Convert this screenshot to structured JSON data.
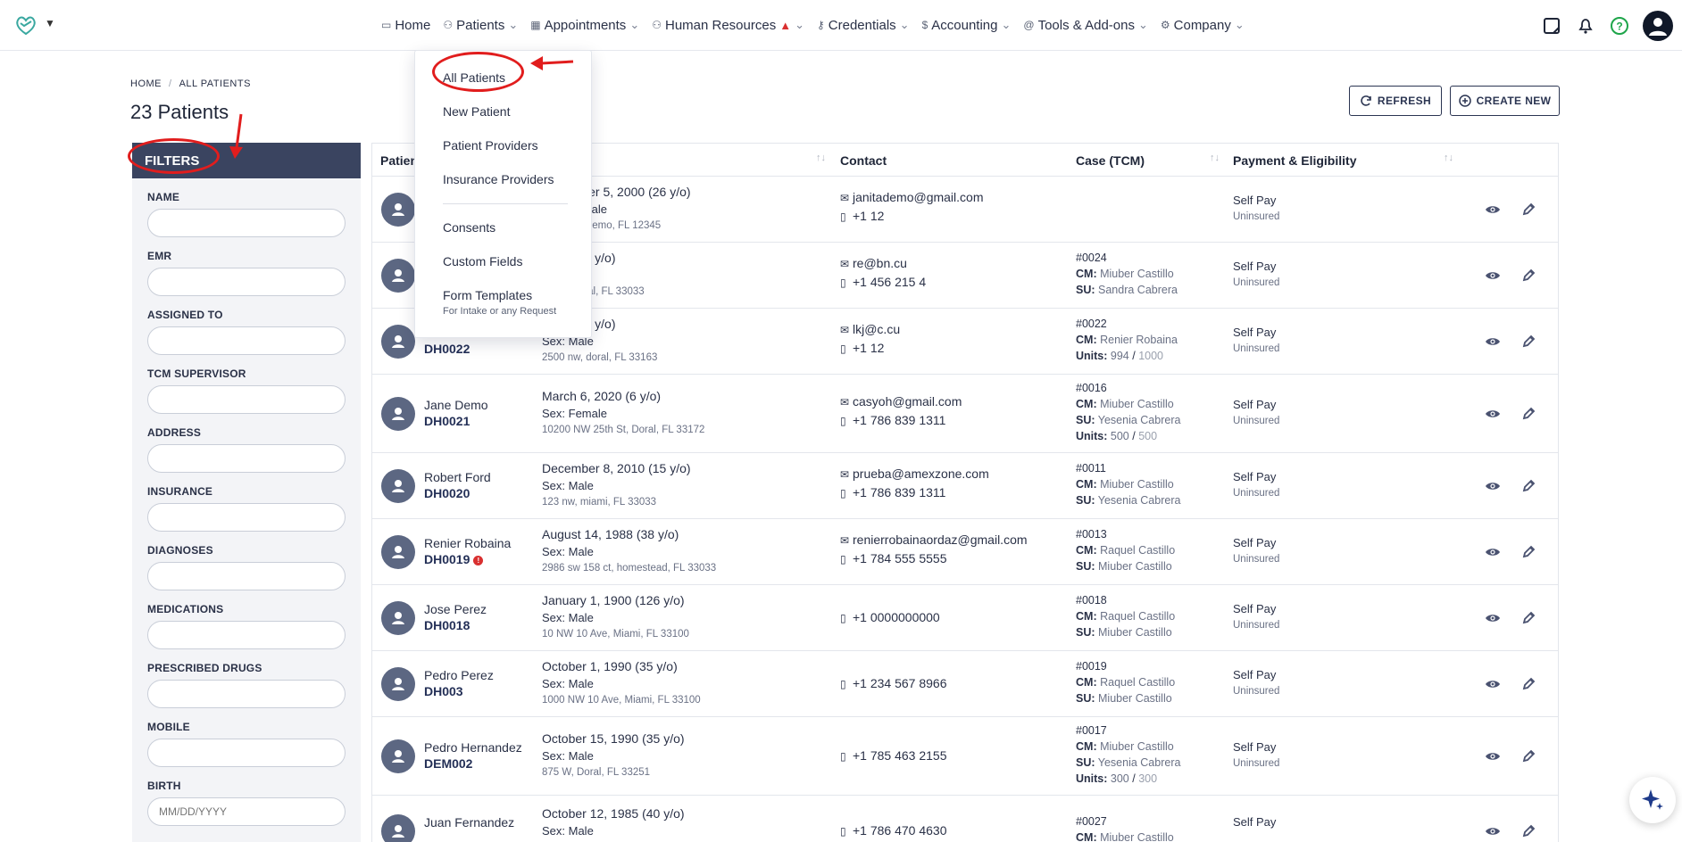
{
  "nav": {
    "items": [
      {
        "label": "Home",
        "icon": "monitor-icon",
        "chevron": false
      },
      {
        "label": "Patients",
        "icon": "users-icon",
        "chevron": true
      },
      {
        "label": "Appointments",
        "icon": "calendar-icon",
        "chevron": true
      },
      {
        "label": "Human Resources",
        "icon": "user-plus-icon",
        "chevron": true,
        "warning": true
      },
      {
        "label": "Credentials",
        "icon": "key-icon",
        "chevron": true
      },
      {
        "label": "Accounting",
        "icon": "dollar-icon",
        "chevron": true
      },
      {
        "label": "Tools & Add-ons",
        "icon": "at-icon",
        "chevron": true
      },
      {
        "label": "Company",
        "icon": "gear-icon",
        "chevron": true
      }
    ]
  },
  "breadcrumb": {
    "home": "HOME",
    "sep": "/",
    "current": "ALL PATIENTS"
  },
  "page_title": "23 Patients",
  "actions": {
    "refresh": "REFRESH",
    "create": "CREATE NEW"
  },
  "filters": {
    "title": "FILTERS",
    "fields": [
      "NAME",
      "EMR",
      "ASSIGNED TO",
      "TCM SUPERVISOR",
      "ADDRESS",
      "INSURANCE",
      "DIAGNOSES",
      "MEDICATIONS",
      "PRESCRIBED DRUGS",
      "MOBILE",
      "BIRTH"
    ],
    "birth_placeholder": "MM/DD/YYYY"
  },
  "table": {
    "headers": {
      "patient": "Patient",
      "contact": "Contact",
      "case": "Case (TCM)",
      "payment": "Payment & Eligibility"
    },
    "rows": [
      {
        "name": "",
        "id": "",
        "dob": "November 5, 2000 (26 y/o)",
        "sex": "Sex: Female",
        "address": "2127 nd, Demo, FL 12345",
        "email": "janitademo@gmail.com",
        "phone": "+1 12",
        "case_no": "",
        "cm": "",
        "su": "",
        "units": "",
        "units_total": "",
        "pay": "Self Pay",
        "ins": "Uninsured",
        "alert": false
      },
      {
        "name": "",
        "id": "",
        "dob": "1988 (38 y/o)",
        "sex": "",
        "address": "3 ave, doral, FL 33033",
        "email": "re@bn.cu",
        "phone": "+1 456 215 4",
        "case_no": "#0024",
        "cm": "Miuber Castillo",
        "su": "Sandra Cabrera",
        "units": "",
        "units_total": "",
        "pay": "Self Pay",
        "ins": "Uninsured",
        "alert": false
      },
      {
        "name": "",
        "id": "DH0022",
        "dob": "1986 (40 y/o)",
        "sex": "Sex: Male",
        "address": "2500 nw, doral, FL 33163",
        "email": "lkj@c.cu",
        "phone": "+1 12",
        "case_no": "#0022",
        "cm": "Renier Robaina",
        "su": "",
        "units": "994",
        "units_total": "1000",
        "pay": "Self Pay",
        "ins": "Uninsured",
        "alert": false
      },
      {
        "name": "Jane Demo",
        "id": "DH0021",
        "dob": "March 6, 2020 (6 y/o)",
        "sex": "Sex: Female",
        "address": "10200 NW 25th St, Doral, FL 33172",
        "email": "casyoh@gmail.com",
        "phone": "+1 786 839 1311",
        "case_no": "#0016",
        "cm": "Miuber Castillo",
        "su": "Yesenia Cabrera",
        "units": "500",
        "units_total": "500",
        "pay": "Self Pay",
        "ins": "Uninsured",
        "alert": false
      },
      {
        "name": "Robert Ford",
        "id": "DH0020",
        "dob": "December 8, 2010 (15 y/o)",
        "sex": "Sex: Male",
        "address": "123 nw, miami, FL 33033",
        "email": "prueba@amexzone.com",
        "phone": "+1 786 839 1311",
        "case_no": "#0011",
        "cm": "Miuber Castillo",
        "su": "Yesenia Cabrera",
        "units": "",
        "units_total": "",
        "pay": "Self Pay",
        "ins": "Uninsured",
        "alert": false
      },
      {
        "name": "Renier Robaina",
        "id": "DH0019",
        "dob": "August 14, 1988 (38 y/o)",
        "sex": "Sex: Male",
        "address": "2986 sw 158 ct, homestead, FL 33033",
        "email": "renierrobainaordaz@gmail.com",
        "phone": "+1 784 555 5555",
        "case_no": "#0013",
        "cm": "Raquel Castillo",
        "su": "Miuber Castillo",
        "units": "",
        "units_total": "",
        "pay": "Self Pay",
        "ins": "Uninsured",
        "alert": true
      },
      {
        "name": "Jose Perez",
        "id": "DH0018",
        "dob": "January 1, 1900 (126 y/o)",
        "sex": "Sex: Male",
        "address": "10 NW 10 Ave, Miami, FL 33100",
        "email": "",
        "phone": "+1 0000000000",
        "case_no": "#0018",
        "cm": "Raquel Castillo",
        "su": "Miuber Castillo",
        "units": "",
        "units_total": "",
        "pay": "Self Pay",
        "ins": "Uninsured",
        "alert": false
      },
      {
        "name": "Pedro Perez",
        "id": "DH003",
        "dob": "October 1, 1990 (35 y/o)",
        "sex": "Sex: Male",
        "address": "1000 NW 10 Ave, Miami, FL 33100",
        "email": "",
        "phone": "+1 234 567 8966",
        "case_no": "#0019",
        "cm": "Raquel Castillo",
        "su": "Miuber Castillo",
        "units": "",
        "units_total": "",
        "pay": "Self Pay",
        "ins": "Uninsured",
        "alert": false
      },
      {
        "name": "Pedro Hernandez",
        "id": "DEM002",
        "dob": "October 15, 1990 (35 y/o)",
        "sex": "Sex: Male",
        "address": "875 W, Doral, FL 33251",
        "email": "",
        "phone": "+1 785 463 2155",
        "case_no": "#0017",
        "cm": "Miuber Castillo",
        "su": "Yesenia Cabrera",
        "units": "300",
        "units_total": "300",
        "pay": "Self Pay",
        "ins": "Uninsured",
        "alert": false
      },
      {
        "name": "Juan Fernandez",
        "id": "",
        "dob": "October 12, 1985 (40 y/o)",
        "sex": "Sex: Male",
        "address": "",
        "email": "",
        "phone": "+1 786 470 4630",
        "case_no": "#0027",
        "cm": "Miuber Castillo",
        "su": "",
        "units": "",
        "units_total": "",
        "pay": "Self Pay",
        "ins": "",
        "alert": false
      }
    ]
  },
  "labels": {
    "cm": "CM:",
    "su": "SU:",
    "units": "Units:"
  },
  "dropdown": {
    "items": [
      "All Patients",
      "New Patient",
      "Patient Providers",
      "Insurance Providers",
      "Consents",
      "Custom Fields",
      "Form Templates"
    ],
    "form_templates_sub": "For Intake or any Request"
  },
  "colors": {
    "accent": "#2b3552",
    "filters_header": "#3a4460",
    "annotation": "#e11d1d",
    "alert": "#d93030"
  }
}
